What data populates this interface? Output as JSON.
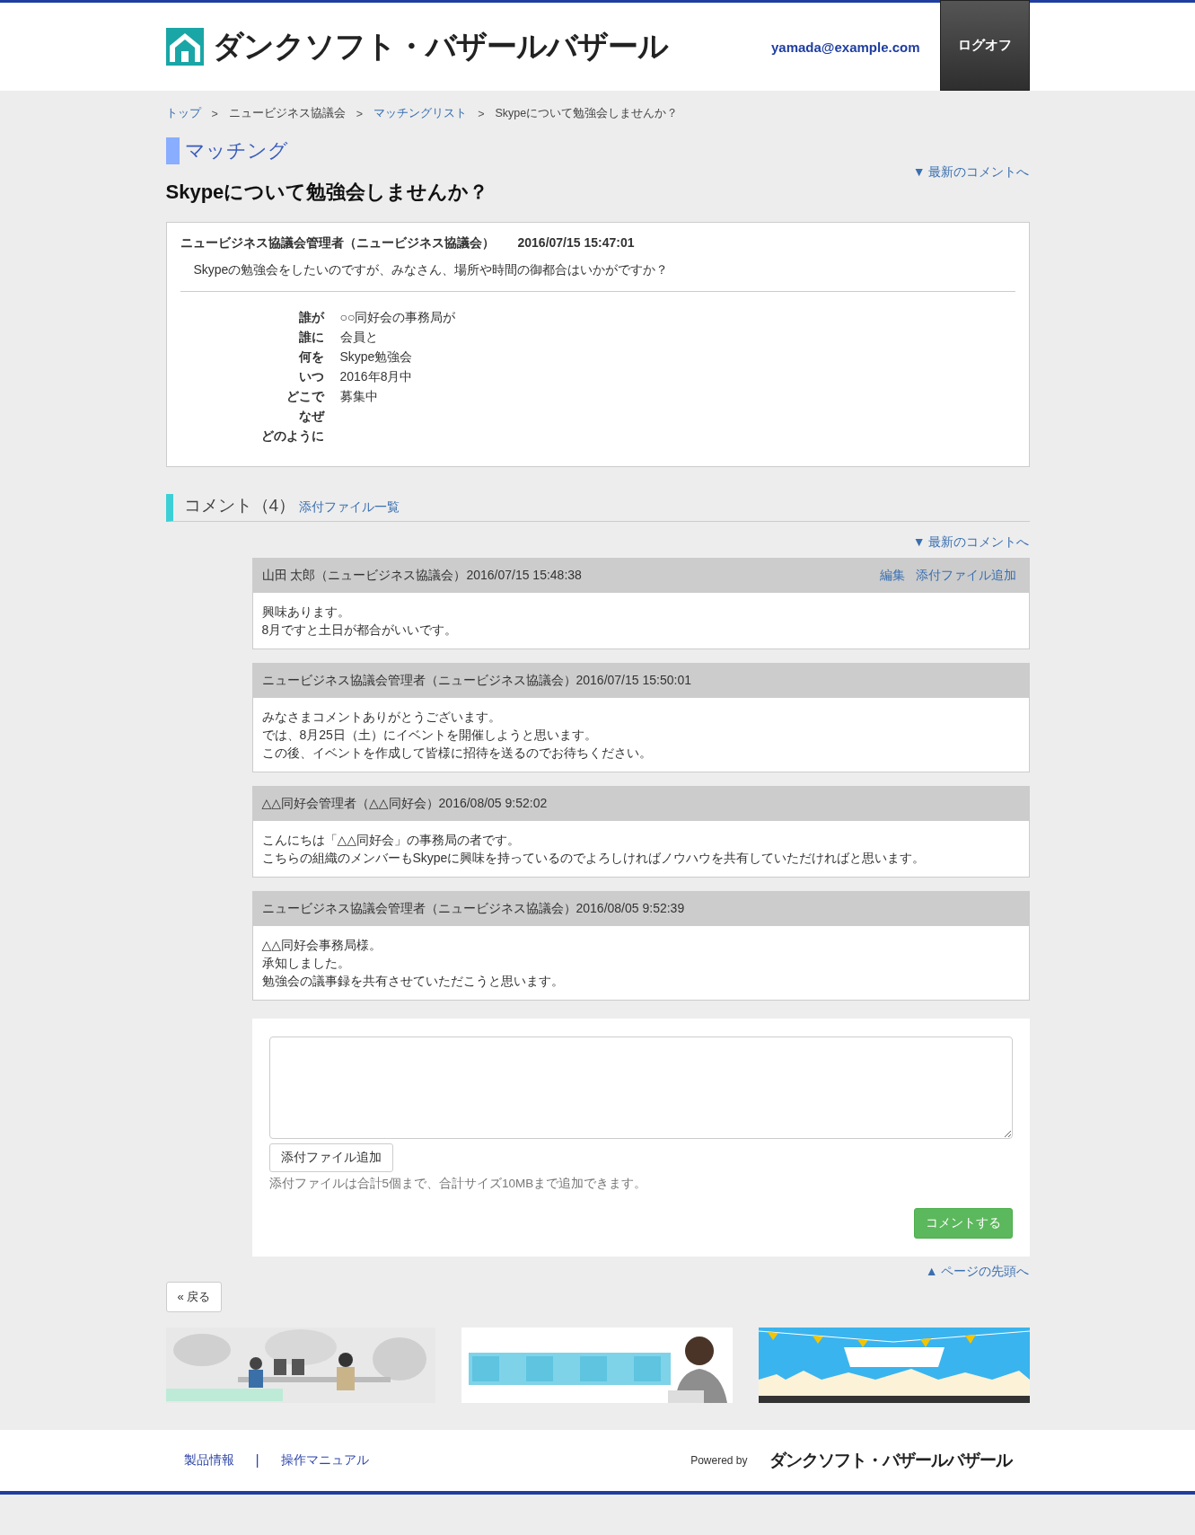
{
  "header": {
    "logo": "ダンクソフト・バザールバザール",
    "user": "yamada@example.com",
    "logoff": "ログオフ"
  },
  "breadcrumb": [
    {
      "label": "トップ",
      "kind": "link"
    },
    {
      "label": "ニュービジネス協議会",
      "kind": "text"
    },
    {
      "label": "マッチングリスト",
      "kind": "link"
    },
    {
      "label": "Skypeについて勉強会しませんか？",
      "kind": "text"
    }
  ],
  "breadcrumb_separator": ">",
  "section_title": "マッチング",
  "topic_title": "Skypeについて勉強会しませんか？",
  "latest_link_top": "▼ 最新のコメントへ",
  "post": {
    "author": "ニュービジネス協議会管理者（ニュービジネス協議会）",
    "datetime": "2016/07/15 15:47:01",
    "body": "Skypeの勉強会をしたいのですが、みなさん、場所や時間の御都合はいかがですか？",
    "fields": [
      {
        "label": "誰が",
        "value": "○○同好会の事務局が"
      },
      {
        "label": "誰に",
        "value": "会員と"
      },
      {
        "label": "何を",
        "value": "Skype勉強会"
      },
      {
        "label": "いつ",
        "value": "2016年8月中"
      },
      {
        "label": "どこで",
        "value": "募集中"
      },
      {
        "label": "なぜ"
      },
      {
        "label": "どのように"
      }
    ]
  },
  "comments_section": {
    "title": "コメント（4）",
    "files_link": "添付ファイル一覧",
    "latest_link": "▼ 最新のコメントへ"
  },
  "comments": [
    {
      "header": "山田 太郎（ニュービジネス協議会）2016/07/15 15:48:38",
      "actions": [
        "編集",
        "添付ファイル追加"
      ],
      "lines": [
        "興味あります。",
        "8月ですと土日が都合がいいです。"
      ]
    },
    {
      "header": "ニュービジネス協議会管理者（ニュービジネス協議会）2016/07/15 15:50:01",
      "lines": [
        "みなさまコメントありがとうございます。",
        "では、8月25日（土）にイベントを開催しようと思います。",
        "この後、イベントを作成して皆様に招待を送るのでお待ちください。"
      ]
    },
    {
      "header": "△△同好会管理者（△△同好会）2016/08/05 9:52:02",
      "lines": [
        "こんにちは「△△同好会」の事務局の者です。",
        "こちらの組織のメンバーもSkypeに興味を持っているのでよろしければノウハウを共有していただければと思います。"
      ]
    },
    {
      "header": "ニュービジネス協議会管理者（ニュービジネス協議会）2016/08/05 9:52:39",
      "lines": [
        "△△同好会事務局様。",
        "承知しました。",
        "勉強会の議事録を共有させていただこうと思います。"
      ]
    }
  ],
  "form": {
    "attach_button": "添付ファイル追加",
    "note": "添付ファイルは合計5個まで、合計サイズ10MBまで追加できます。",
    "submit": "コメントする"
  },
  "page_top_link": "▲ ページの先頭へ",
  "back_button": "« 戻る",
  "banners": [
    {
      "kind": "office"
    },
    {
      "kind": "telework"
    },
    {
      "kind": "town"
    }
  ],
  "footer": {
    "links": [
      "製品情報",
      "操作マニュアル"
    ],
    "separator": "|",
    "powered_by": "Powered by",
    "logo": "ダンクソフト・バザールバザール"
  }
}
